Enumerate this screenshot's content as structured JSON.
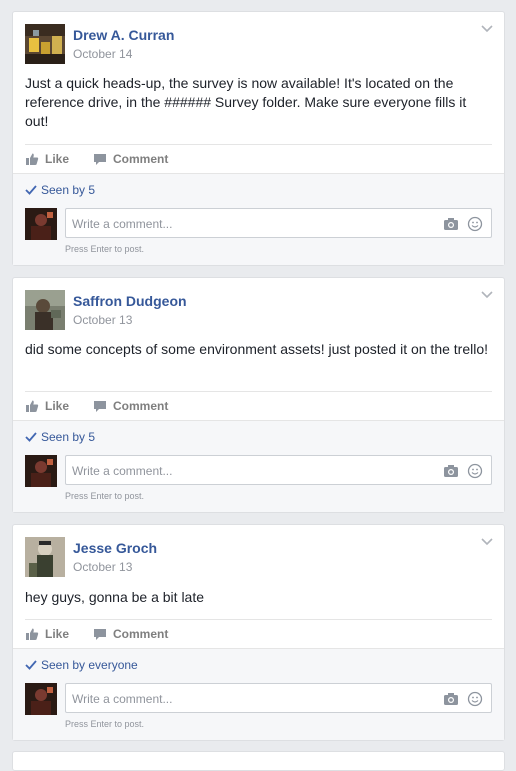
{
  "colors": {
    "page_bg": "#e9ebee",
    "link": "#365899",
    "muted": "#90949c",
    "action": "#7f7f7f"
  },
  "posts": [
    {
      "author": "Drew A. Curran",
      "date": "October 14",
      "text": "Just a quick heads-up, the survey is now available! It's located on the reference drive, in the ###### Survey folder. Make sure everyone fills it out!",
      "like_label": "Like",
      "comment_label": "Comment",
      "seen": "Seen by 5",
      "comment_placeholder": "Write a comment...",
      "hint": "Press Enter to post."
    },
    {
      "author": "Saffron Dudgeon",
      "date": "October 13",
      "text": "did some concepts of some environment assets! just posted it on the trello!",
      "like_label": "Like",
      "comment_label": "Comment",
      "seen": "Seen by 5",
      "comment_placeholder": "Write a comment...",
      "hint": "Press Enter to post."
    },
    {
      "author": "Jesse Groch",
      "date": "October 13",
      "text": "hey guys, gonna be a bit late",
      "like_label": "Like",
      "comment_label": "Comment",
      "seen": "Seen by everyone",
      "comment_placeholder": "Write a comment...",
      "hint": "Press Enter to post."
    }
  ]
}
